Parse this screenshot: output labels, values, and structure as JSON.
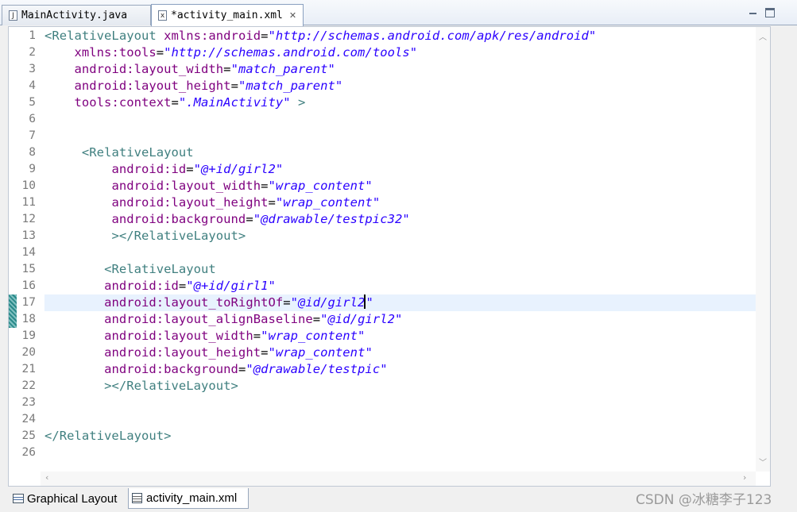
{
  "tabs": [
    {
      "label": "MainActivity.java",
      "icon": "java-file-icon"
    },
    {
      "label": "*activity_main.xml",
      "icon": "xml-file-icon",
      "close": "✕"
    }
  ],
  "bottom_tabs": [
    {
      "label": "Graphical Layout"
    },
    {
      "label": "activity_main.xml"
    }
  ],
  "watermark": "CSDN @冰糖李子123",
  "colors": {
    "tag": "#3f7f7f",
    "attribute": "#7f007f",
    "value": "#2a00ff",
    "highlight_line": "#e8f2fe"
  },
  "editor": {
    "current_line": 17,
    "lines": [
      {
        "n": "1",
        "segs": [
          [
            "tag",
            "<RelativeLayout"
          ],
          [
            "sym",
            " "
          ],
          [
            "attr",
            "xmlns:android"
          ],
          [
            "sym",
            "="
          ],
          [
            "val",
            "\"http://schemas.android.com/apk/res/android\""
          ]
        ]
      },
      {
        "n": "2",
        "segs": [
          [
            "sym",
            "    "
          ],
          [
            "attr",
            "xmlns:tools"
          ],
          [
            "sym",
            "="
          ],
          [
            "val",
            "\"http://schemas.android.com/tools\""
          ]
        ]
      },
      {
        "n": "3",
        "segs": [
          [
            "sym",
            "    "
          ],
          [
            "attr",
            "android:layout_width"
          ],
          [
            "sym",
            "="
          ],
          [
            "val",
            "\"match_parent\""
          ]
        ]
      },
      {
        "n": "4",
        "segs": [
          [
            "sym",
            "    "
          ],
          [
            "attr",
            "android:layout_height"
          ],
          [
            "sym",
            "="
          ],
          [
            "val",
            "\"match_parent\""
          ]
        ]
      },
      {
        "n": "5",
        "segs": [
          [
            "sym",
            "    "
          ],
          [
            "attr",
            "tools:context"
          ],
          [
            "sym",
            "="
          ],
          [
            "val",
            "\".MainActivity\""
          ],
          [
            "sym",
            " "
          ],
          [
            "tag",
            ">"
          ]
        ]
      },
      {
        "n": "6",
        "segs": []
      },
      {
        "n": "7",
        "segs": []
      },
      {
        "n": "8",
        "segs": [
          [
            "sym",
            "     "
          ],
          [
            "tag",
            "<RelativeLayout"
          ]
        ]
      },
      {
        "n": "9",
        "segs": [
          [
            "sym",
            "         "
          ],
          [
            "attr",
            "android:id"
          ],
          [
            "sym",
            "="
          ],
          [
            "val",
            "\"@+id/girl2\""
          ]
        ]
      },
      {
        "n": "10",
        "segs": [
          [
            "sym",
            "         "
          ],
          [
            "attr",
            "android:layout_width"
          ],
          [
            "sym",
            "="
          ],
          [
            "val",
            "\"wrap_content\""
          ]
        ]
      },
      {
        "n": "11",
        "segs": [
          [
            "sym",
            "         "
          ],
          [
            "attr",
            "android:layout_height"
          ],
          [
            "sym",
            "="
          ],
          [
            "val",
            "\"wrap_content\""
          ]
        ]
      },
      {
        "n": "12",
        "segs": [
          [
            "sym",
            "         "
          ],
          [
            "attr",
            "android:background"
          ],
          [
            "sym",
            "="
          ],
          [
            "val",
            "\"@drawable/testpic32\""
          ]
        ]
      },
      {
        "n": "13",
        "segs": [
          [
            "sym",
            "         "
          ],
          [
            "tag",
            "></RelativeLayout>"
          ]
        ]
      },
      {
        "n": "14",
        "segs": []
      },
      {
        "n": "15",
        "segs": [
          [
            "sym",
            "        "
          ],
          [
            "tag",
            "<RelativeLayout"
          ]
        ]
      },
      {
        "n": "16",
        "segs": [
          [
            "sym",
            "        "
          ],
          [
            "attr",
            "android:id"
          ],
          [
            "sym",
            "="
          ],
          [
            "val",
            "\"@+id/girl1\""
          ]
        ]
      },
      {
        "n": "17",
        "segs": [
          [
            "sym",
            "        "
          ],
          [
            "attr",
            "android:layout_toRightOf"
          ],
          [
            "sym",
            "="
          ],
          [
            "val",
            "\"@id/girl2"
          ],
          [
            "caret",
            ""
          ],
          [
            "val",
            "\""
          ]
        ]
      },
      {
        "n": "18",
        "segs": [
          [
            "sym",
            "        "
          ],
          [
            "attr",
            "android:layout_alignBaseline"
          ],
          [
            "sym",
            "="
          ],
          [
            "val",
            "\"@id/girl2\""
          ]
        ]
      },
      {
        "n": "19",
        "segs": [
          [
            "sym",
            "        "
          ],
          [
            "attr",
            "android:layout_width"
          ],
          [
            "sym",
            "="
          ],
          [
            "val",
            "\"wrap_content\""
          ]
        ]
      },
      {
        "n": "20",
        "segs": [
          [
            "sym",
            "        "
          ],
          [
            "attr",
            "android:layout_height"
          ],
          [
            "sym",
            "="
          ],
          [
            "val",
            "\"wrap_content\""
          ]
        ]
      },
      {
        "n": "21",
        "segs": [
          [
            "sym",
            "        "
          ],
          [
            "attr",
            "android:background"
          ],
          [
            "sym",
            "="
          ],
          [
            "val",
            "\"@drawable/testpic\""
          ]
        ]
      },
      {
        "n": "22",
        "segs": [
          [
            "sym",
            "        "
          ],
          [
            "tag",
            "></RelativeLayout>"
          ]
        ]
      },
      {
        "n": "23",
        "segs": []
      },
      {
        "n": "24",
        "segs": []
      },
      {
        "n": "25",
        "segs": [
          [
            "tag",
            "</RelativeLayout>"
          ]
        ]
      },
      {
        "n": "26",
        "segs": []
      }
    ]
  }
}
